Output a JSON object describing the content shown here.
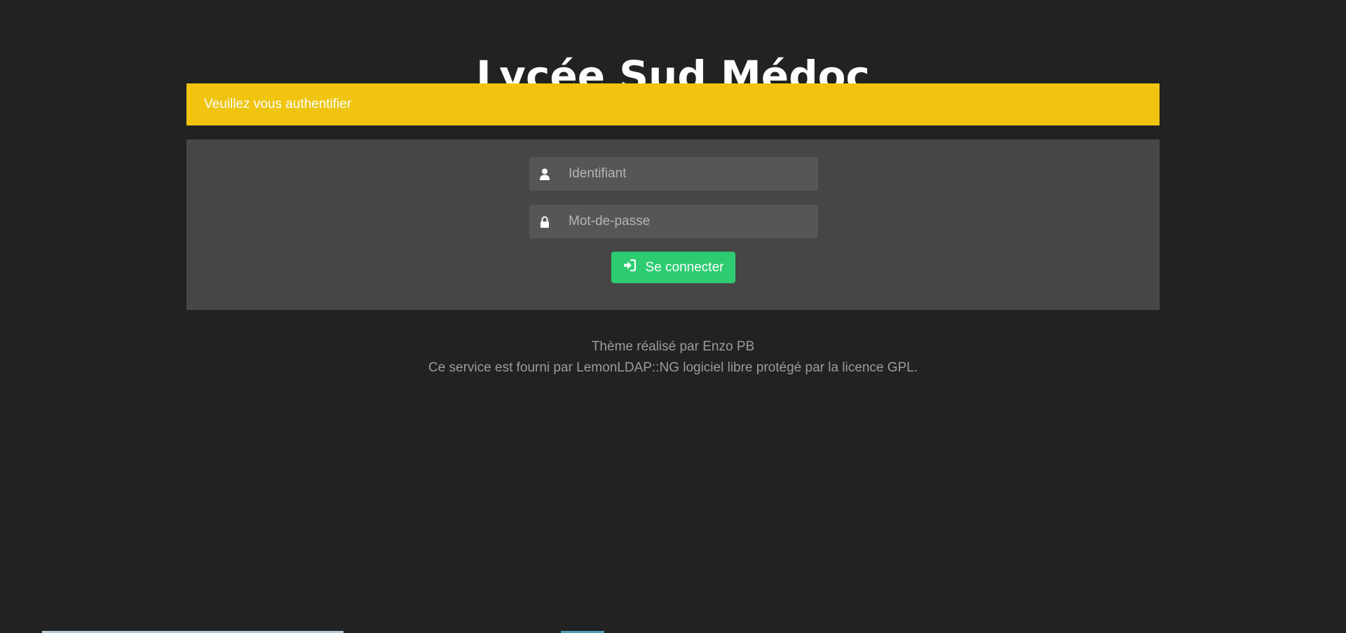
{
  "header": {
    "title": "Lycée Sud Médoc"
  },
  "alert": {
    "message": "Veuillez vous authentifier",
    "color": "#f1c40f"
  },
  "login_form": {
    "login_field": {
      "icon": "user-icon",
      "placeholder": "Identifiant",
      "value": ""
    },
    "password_field": {
      "icon": "lock-icon",
      "placeholder": "Mot-de-passe",
      "value": ""
    },
    "submit_button": {
      "icon": "sign-in-icon",
      "label": "Se connecter",
      "color": "#2ecc71"
    }
  },
  "footer": {
    "theme_credit": "Thème réalisé par Enzo PB",
    "service_notice": "Ce service est fourni par LemonLDAP::NG logiciel libre protégé par la licence GPL."
  }
}
